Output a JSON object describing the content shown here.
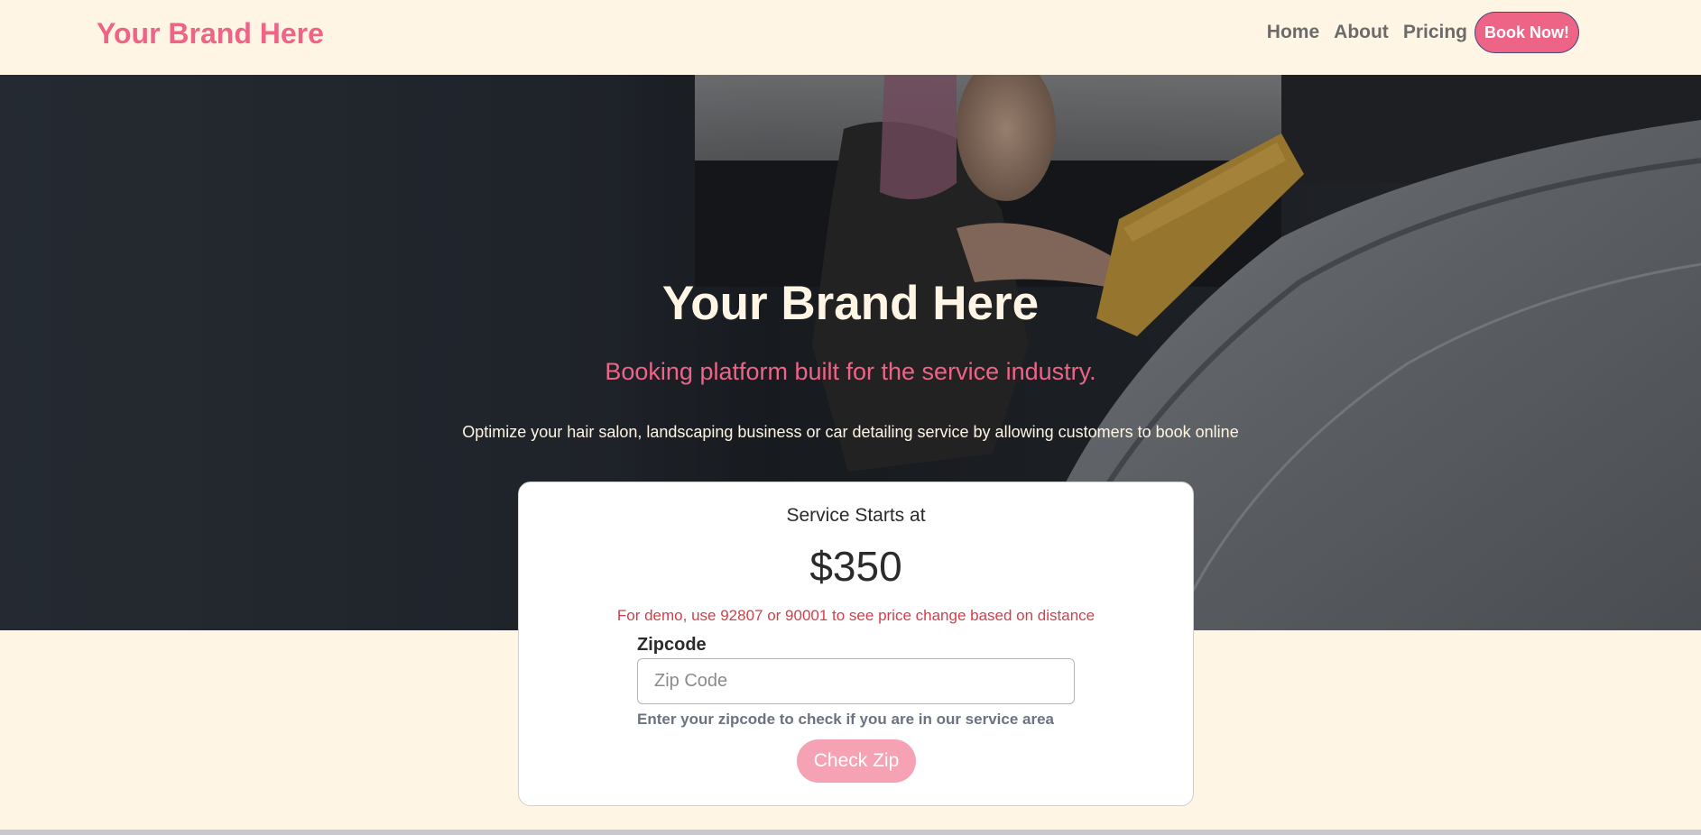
{
  "navbar": {
    "brand": "Your Brand Here",
    "links": [
      {
        "label": "Home"
      },
      {
        "label": "About"
      },
      {
        "label": "Pricing"
      }
    ],
    "cta_label": "Book Now!"
  },
  "hero": {
    "title": "Your Brand Here",
    "subtitle": "Booking platform built for the service industry.",
    "description": "Optimize your hair salon, landscaping business or car detailing service by allowing customers to book online"
  },
  "card": {
    "label": "Service Starts at",
    "price": "$350",
    "note": "For demo, use 92807 or 90001 to see price change based on distance",
    "zip_label": "Zipcode",
    "zip_placeholder": "Zip Code",
    "zip_value": "",
    "zip_help": "Enter your zipcode to check if you are in our service area",
    "check_label": "Check Zip"
  },
  "colors": {
    "accent": "#ee6487",
    "background": "#fff5e4",
    "note": "#d23f4a",
    "button_disabled": "#f5a3b4"
  }
}
